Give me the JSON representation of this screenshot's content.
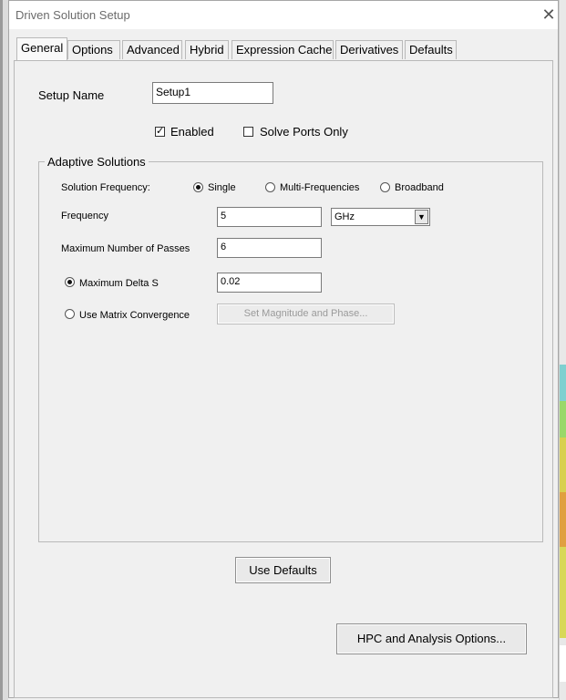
{
  "window": {
    "title": "Driven Solution Setup",
    "close_glyph": "✕"
  },
  "tabs": [
    {
      "label": "General",
      "active": true
    },
    {
      "label": "Options"
    },
    {
      "label": "Advanced"
    },
    {
      "label": "Hybrid"
    },
    {
      "label": "Expression Cache"
    },
    {
      "label": "Derivatives"
    },
    {
      "label": "Defaults"
    }
  ],
  "general": {
    "setup_name_label": "Setup Name",
    "setup_name_value": "Setup1",
    "enabled_label": "Enabled",
    "enabled_checked": true,
    "solve_ports_only_label": "Solve Ports Only",
    "solve_ports_only_checked": false
  },
  "adaptive": {
    "group_title": "Adaptive Solutions",
    "solution_frequency_label": "Solution Frequency:",
    "freq_mode_options": [
      "Single",
      "Multi-Frequencies",
      "Broadband"
    ],
    "freq_mode_selected": "Single",
    "frequency_label": "Frequency",
    "frequency_value": "5",
    "frequency_unit": "GHz",
    "max_passes_label": "Maximum Number of Passes",
    "max_passes_value": "6",
    "max_delta_s_label": "Maximum Delta S",
    "max_delta_s_value": "0.02",
    "max_delta_s_selected": true,
    "use_matrix_label": "Use Matrix Convergence",
    "use_matrix_selected": false,
    "set_mag_phase_label": "Set Magnitude and Phase..."
  },
  "buttons": {
    "use_defaults": "Use Defaults",
    "hpc_options": "HPC and Analysis Options..."
  },
  "icons": {
    "check": "✓",
    "dropdown": "▼"
  }
}
